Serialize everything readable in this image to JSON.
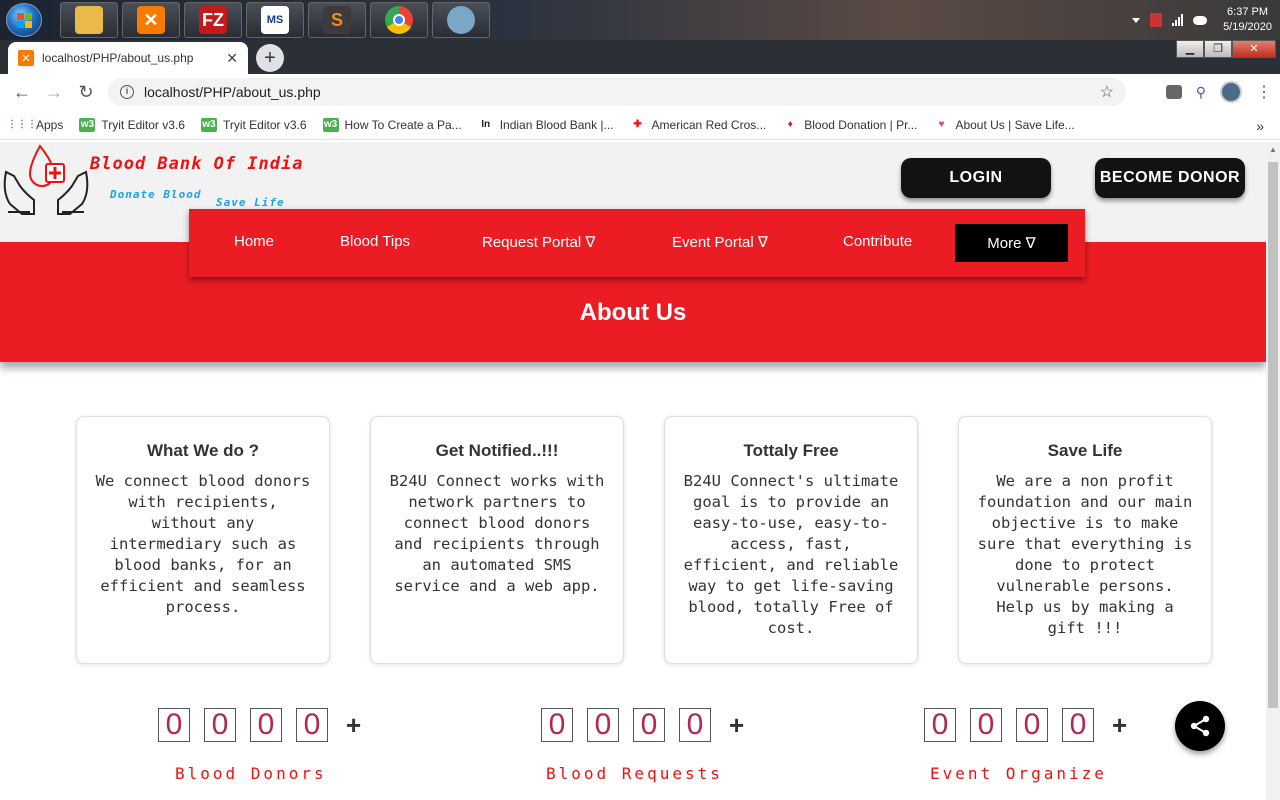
{
  "taskbar": {
    "apps": [
      {
        "name": "explorer",
        "icon": "folder-icon",
        "color": "#e9b949"
      },
      {
        "name": "xampp",
        "icon": "xampp-icon",
        "color": "#f57c00"
      },
      {
        "name": "filezilla",
        "icon": "filezilla-icon",
        "color": "#c31b1b",
        "glyph": "FZ"
      },
      {
        "name": "ms-word",
        "icon": "word-icon",
        "color": "#ffffff"
      },
      {
        "name": "sublime",
        "icon": "sublime-icon",
        "color": "#f48a1f",
        "glyph": "S"
      },
      {
        "name": "chrome",
        "icon": "chrome-icon",
        "color": "#4285f4"
      },
      {
        "name": "paint",
        "icon": "paint-icon",
        "color": "#7aa6c8"
      }
    ],
    "clock_time": "6:37 PM",
    "clock_date": "5/19/2020"
  },
  "browser": {
    "tab_title": "localhost/PHP/about_us.php",
    "url": "localhost/PHP/about_us.php",
    "bookmarks": [
      {
        "label": "Apps",
        "icon": "apps-grid-icon",
        "color": "#e44"
      },
      {
        "label": "Tryit Editor v3.6",
        "icon": "w3-icon",
        "color": "#4caf50"
      },
      {
        "label": "Tryit Editor v3.6",
        "icon": "w3-icon",
        "color": "#4caf50"
      },
      {
        "label": "How To Create a Pa...",
        "icon": "w3-icon",
        "color": "#4caf50"
      },
      {
        "label": "Indian Blood Bank |...",
        "icon": "ibb-icon",
        "color": "#222222"
      },
      {
        "label": "American Red Cros...",
        "icon": "red-cross-icon",
        "color": "#e11"
      },
      {
        "label": "Blood Donation | Pr...",
        "icon": "blood-drop-icon",
        "color": "#c1272d"
      },
      {
        "label": "About Us | Save Life...",
        "icon": "heart-icon",
        "color": "#e0457b"
      }
    ],
    "more_label": "»"
  },
  "site": {
    "logo_title": "Blood Bank Of India",
    "logo_tag1": "Donate Blood",
    "logo_tag2": "Save Life",
    "login_label": "LOGIN",
    "donor_label": "BECOME DONOR",
    "nav": [
      "Home",
      "Blood Tips",
      "Request Portal ∇",
      "Event Portal ∇",
      "Contribute"
    ],
    "nav_more": "More ∇",
    "page_title": "About Us",
    "accent": "#ec1c24",
    "cards": [
      {
        "title": "What We do ?",
        "text": "We connect blood donors with recipients, without any intermediary such as blood banks, for an efficient and seamless process."
      },
      {
        "title": "Get Notified..!!!",
        "text": "B24U Connect works with network partners to connect blood donors and recipients through an automated SMS service and a web app."
      },
      {
        "title": "Tottaly Free",
        "text": "B24U Connect's ultimate goal is to provide an easy-to-use, easy-to-access, fast, efficient, and reliable way to get life-saving blood, totally Free of cost."
      },
      {
        "title": "Save Life",
        "text": "We are a non profit foundation and our main objective is to make sure that everything is done to protect vulnerable persons. Help us by making a gift !!!"
      }
    ],
    "counters": [
      {
        "digits": [
          "0",
          "0",
          "0",
          "0"
        ],
        "plus": "+",
        "label": "Blood Donors"
      },
      {
        "digits": [
          "0",
          "0",
          "0",
          "0"
        ],
        "plus": "+",
        "label": "Blood Requests"
      },
      {
        "digits": [
          "0",
          "0",
          "0",
          "0"
        ],
        "plus": "+",
        "label": "Event Organize"
      }
    ]
  }
}
